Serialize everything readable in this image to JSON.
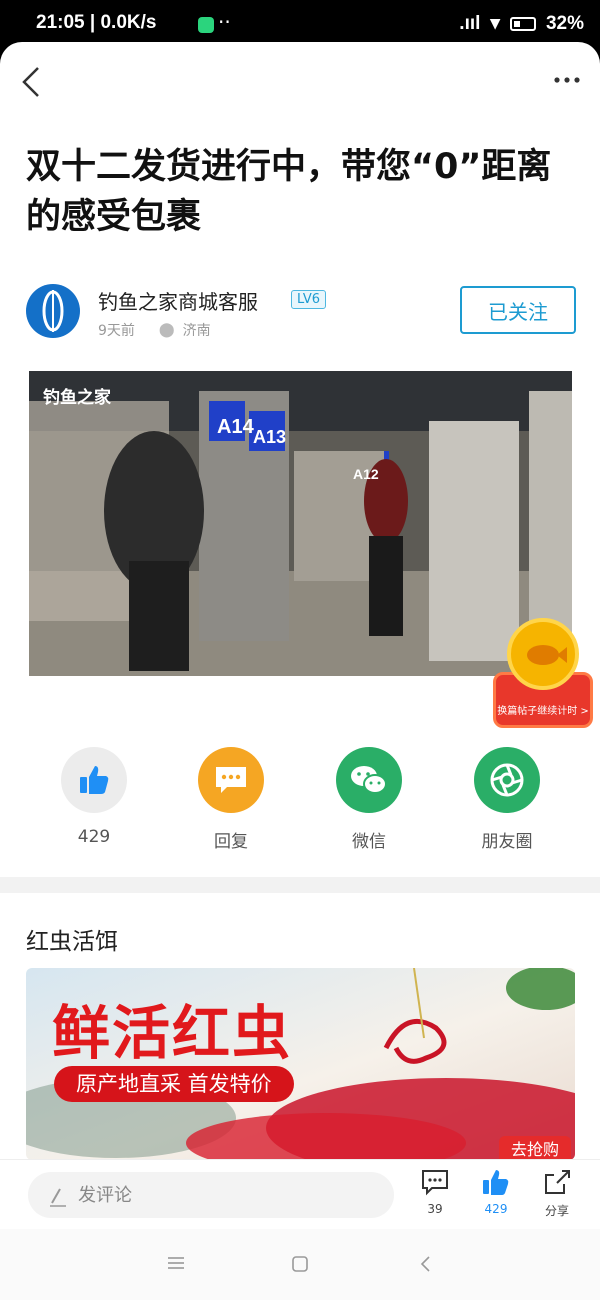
{
  "status_bar": {
    "time": "21:05 | 0.0K/s",
    "battery": "32%"
  },
  "post": {
    "title": "双十二发货进行中，带您“0”距离的感受包裹",
    "author": {
      "name": "钓鱼之家商城客服",
      "level": "LV6",
      "time_ago": "9天前",
      "location": "济南",
      "follow_label": "已关注"
    },
    "photo": {
      "watermark": "钓鱼之家",
      "rack_labels": [
        "A14",
        "A13",
        "A12"
      ]
    },
    "float_badge_text": "换篇帖子继续计时 >"
  },
  "actions": [
    {
      "label": "429",
      "icon": "thumbs-up-icon",
      "color": "#1f8ff5"
    },
    {
      "label": "回复",
      "icon": "reply-bubble-icon",
      "color": "#f5a623"
    },
    {
      "label": "微信",
      "icon": "wechat-icon",
      "color": "#2aae67"
    },
    {
      "label": "朋友圈",
      "icon": "moments-icon",
      "color": "#2aae67"
    }
  ],
  "section": {
    "title": "红虫活饵",
    "banner": {
      "headline": "鲜活红虫",
      "subline": "原产地直采 首发特价",
      "cta": "去抢购"
    }
  },
  "bottom_bar": {
    "comment_placeholder": "发评论",
    "comments_count": "39",
    "likes_count": "429",
    "share_label": "分享"
  },
  "colors": {
    "accent": "#1d9bd1",
    "like_blue": "#1f8ff5",
    "promo_red": "#e1191c"
  }
}
